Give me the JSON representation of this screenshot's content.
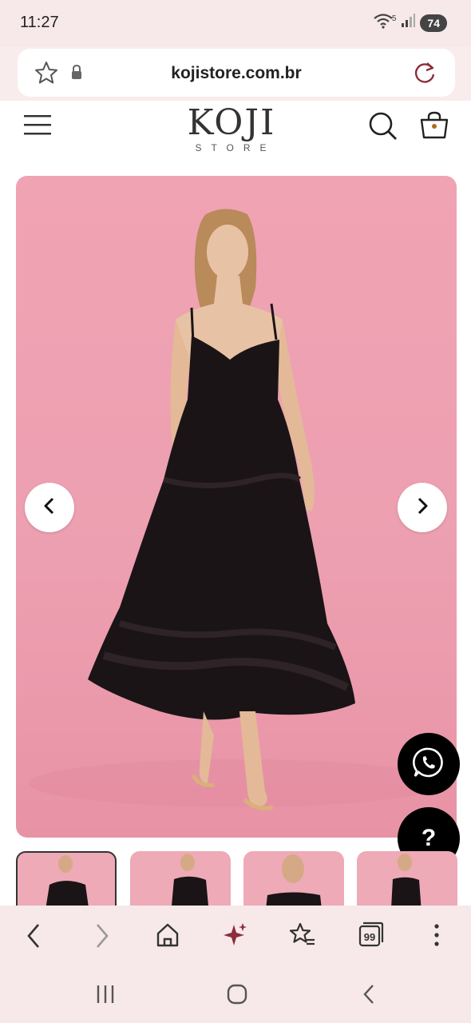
{
  "status_bar": {
    "time": "11:27",
    "battery": "74",
    "wifi_badge": "5"
  },
  "browser": {
    "url": "kojistore.com.br"
  },
  "site": {
    "logo_main": "KOJI",
    "logo_sub": "STORE"
  },
  "floating": {
    "help_label": "?"
  },
  "toolbar": {
    "tab_count": "99"
  },
  "colors": {
    "brand_accent": "#8b2d3a",
    "image_background": "#ec9fb0",
    "chrome_background": "#f7e8e9"
  }
}
